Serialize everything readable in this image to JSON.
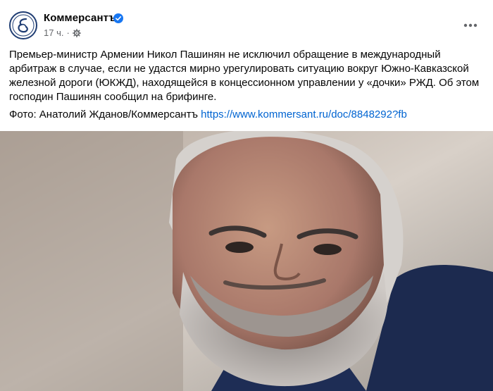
{
  "post": {
    "author": "Коммерсантъ",
    "time": "17 ч.",
    "separator": "·",
    "text": "Премьер-министр Армении Никол Пашинян не исключил обращение в международный арбитраж в случае, если не удастся мирно урегулировать ситуацию вокруг Южно-Кавказской железной дороги (ЮКЖД), находящейся в концессионном управлении у «дочки» РЖД. Об этом господин Пашинян сообщил на брифинге.",
    "photo_credit": "Фото: Анатолий Жданов/Коммерсантъ",
    "link": "https://www.kommersant.ru/doc/8848292?fb"
  },
  "icons": {
    "avatar": "kommersant-logo-icon",
    "verified": "verified-badge-icon",
    "privacy": "gear-icon",
    "more": "more-dots-icon"
  },
  "colors": {
    "link": "#0064d1",
    "verified": "#1877f2",
    "secondary_text": "#65676b",
    "logo": "#1f3d73"
  }
}
